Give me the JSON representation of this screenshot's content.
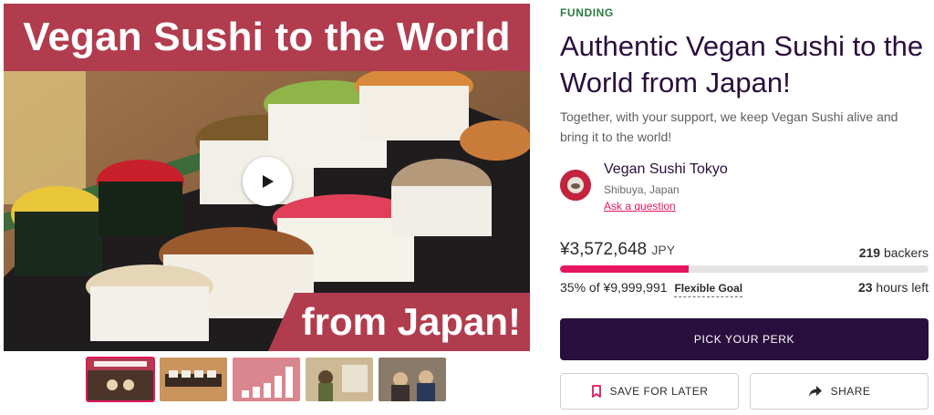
{
  "media": {
    "banner_top": "Vegan Sushi to the World",
    "banner_bottom": "from Japan!",
    "play_icon": "play-icon",
    "thumbnails": [
      {
        "active": true
      },
      {
        "active": false
      },
      {
        "active": false
      },
      {
        "active": false
      },
      {
        "active": false
      }
    ]
  },
  "campaign": {
    "status": "FUNDING",
    "title": "Authentic Vegan Sushi to the World from Japan!",
    "subtitle": "Together, with your support, we keep Vegan Sushi alive and bring it to the world!"
  },
  "owner": {
    "name": "Vegan Sushi Tokyo",
    "location": "Shibuya, Japan",
    "ask_link": "Ask a question"
  },
  "stats": {
    "raised_amount": "¥3,572,648",
    "raised_currency": "JPY",
    "backers_count": "219",
    "backers_label": "backers",
    "progress_percent": 35,
    "goal_text": "35% of ¥9,999,991",
    "goal_type": "Flexible Goal",
    "time_left_value": "23",
    "time_left_label": "hours left"
  },
  "actions": {
    "pick_perk": "PICK YOUR PERK",
    "save_label": "SAVE FOR LATER",
    "save_icon": "bookmark-icon",
    "share_label": "SHARE",
    "share_icon": "share-arrow-icon"
  },
  "colors": {
    "accent": "#e5165f",
    "banner": "#b13c4e",
    "primary_dark": "#2a0e3d",
    "funding_green": "#2b7a3f"
  }
}
